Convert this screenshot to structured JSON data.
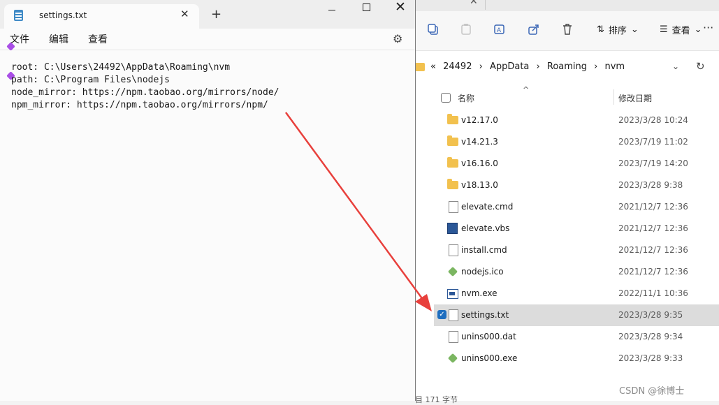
{
  "notepad": {
    "tab_title": "settings.txt",
    "tab_close_glyph": "✕",
    "new_tab_glyph": "+",
    "close_glyph": "✕",
    "gear_glyph": "⚙",
    "menu": [
      "文件",
      "编辑",
      "查看"
    ],
    "lines": [
      "root: C:\\Users\\24492\\AppData\\Roaming\\nvm",
      "path: C:\\Program Files\\nodejs",
      "node_mirror: https://npm.taobao.org/mirrors/node/",
      "npm_mirror: https://npm.taobao.org/mirrors/npm/"
    ]
  },
  "explorer": {
    "tab_close_glyph": "✕",
    "toolbar": {
      "sort_label": "排序",
      "view_label": "查看",
      "more_glyph": "···",
      "chevron": "⌄"
    },
    "breadcrumb": [
      "«",
      "24492",
      "›",
      "AppData",
      "›",
      "Roaming",
      "›",
      "nvm"
    ],
    "address_chevron": "⌄",
    "refresh_glyph": "↻",
    "header": {
      "name": "名称",
      "date": "修改日期",
      "sort_glyph": "^"
    },
    "files": [
      {
        "name": "v12.17.0",
        "date": "2023/3/28 10:24",
        "icon": "folder-icon"
      },
      {
        "name": "v14.21.3",
        "date": "2023/7/19 11:02",
        "icon": "folder-icon"
      },
      {
        "name": "v16.16.0",
        "date": "2023/7/19 14:20",
        "icon": "folder-icon"
      },
      {
        "name": "v18.13.0",
        "date": "2023/3/28 9:38",
        "icon": "folder-icon"
      },
      {
        "name": "elevate.cmd",
        "date": "2021/12/7 12:36",
        "icon": "cmd-file-icon"
      },
      {
        "name": "elevate.vbs",
        "date": "2021/12/7 12:36",
        "icon": "vbs-script-icon"
      },
      {
        "name": "install.cmd",
        "date": "2021/12/7 12:36",
        "icon": "cmd-file-icon"
      },
      {
        "name": "nodejs.ico",
        "date": "2021/12/7 12:36",
        "icon": "nodejs-icon"
      },
      {
        "name": "nvm.exe",
        "date": "2022/11/1 10:36",
        "icon": "exe-icon"
      },
      {
        "name": "settings.txt",
        "date": "2023/3/28 9:35",
        "icon": "text-file-icon",
        "selected": true
      },
      {
        "name": "unins000.dat",
        "date": "2023/3/28 9:34",
        "icon": "blank-file-icon"
      },
      {
        "name": "unins000.exe",
        "date": "2023/3/28 9:33",
        "icon": "nodejs-icon"
      }
    ],
    "status": "目  171 字节",
    "check_glyph": "✓"
  },
  "watermark": "CSDN @徐博士",
  "colors": {
    "arrow": "#e8403c",
    "accent": "#1f6ebf",
    "selection": "#dcdcdc",
    "folder": "#f2c14e"
  }
}
